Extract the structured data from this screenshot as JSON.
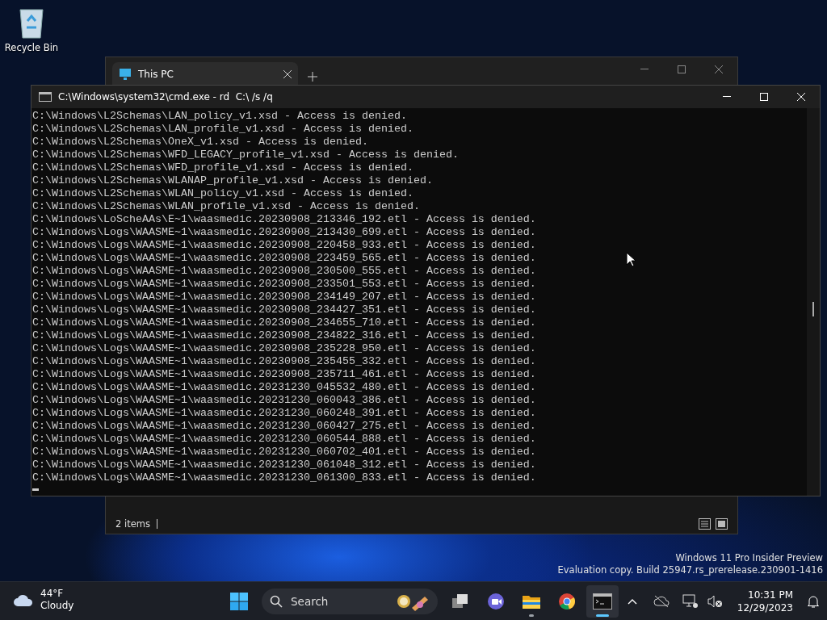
{
  "desktop_icons": [
    {
      "label": "Recycle Bin"
    }
  ],
  "explorer": {
    "tabs": [
      {
        "title": "This PC",
        "selected": true
      }
    ],
    "status": "2 items"
  },
  "console": {
    "title": "C:\\Windows\\system32\\cmd.exe - rd  C:\\ /s /q",
    "lines": [
      "C:\\Windows\\L2Schemas\\LAN_policy_v1.xsd - Access is denied.",
      "C:\\Windows\\L2Schemas\\LAN_profile_v1.xsd - Access is denied.",
      "C:\\Windows\\L2Schemas\\OneX_v1.xsd - Access is denied.",
      "C:\\Windows\\L2Schemas\\WFD_LEGACY_profile_v1.xsd - Access is denied.",
      "C:\\Windows\\L2Schemas\\WFD_profile_v1.xsd - Access is denied.",
      "C:\\Windows\\L2Schemas\\WLANAP_profile_v1.xsd - Access is denied.",
      "C:\\Windows\\L2Schemas\\WLAN_policy_v1.xsd - Access is denied.",
      "C:\\Windows\\L2Schemas\\WLAN_profile_v1.xsd - Access is denied.",
      "C:\\Windows\\LoScheAAs\\E~1\\waasmedic.20230908_213346_192.etl - Access is denied.",
      "C:\\Windows\\Logs\\WAASME~1\\waasmedic.20230908_213430_699.etl - Access is denied.",
      "C:\\Windows\\Logs\\WAASME~1\\waasmedic.20230908_220458_933.etl - Access is denied.",
      "C:\\Windows\\Logs\\WAASME~1\\waasmedic.20230908_223459_565.etl - Access is denied.",
      "C:\\Windows\\Logs\\WAASME~1\\waasmedic.20230908_230500_555.etl - Access is denied.",
      "C:\\Windows\\Logs\\WAASME~1\\waasmedic.20230908_233501_553.etl - Access is denied.",
      "C:\\Windows\\Logs\\WAASME~1\\waasmedic.20230908_234149_207.etl - Access is denied.",
      "C:\\Windows\\Logs\\WAASME~1\\waasmedic.20230908_234427_351.etl - Access is denied.",
      "C:\\Windows\\Logs\\WAASME~1\\waasmedic.20230908_234655_710.etl - Access is denied.",
      "C:\\Windows\\Logs\\WAASME~1\\waasmedic.20230908_234822_316.etl - Access is denied.",
      "C:\\Windows\\Logs\\WAASME~1\\waasmedic.20230908_235228_950.etl - Access is denied.",
      "C:\\Windows\\Logs\\WAASME~1\\waasmedic.20230908_235455_332.etl - Access is denied.",
      "C:\\Windows\\Logs\\WAASME~1\\waasmedic.20230908_235711_461.etl - Access is denied.",
      "C:\\Windows\\Logs\\WAASME~1\\waasmedic.20231230_045532_480.etl - Access is denied.",
      "C:\\Windows\\Logs\\WAASME~1\\waasmedic.20231230_060043_386.etl - Access is denied.",
      "C:\\Windows\\Logs\\WAASME~1\\waasmedic.20231230_060248_391.etl - Access is denied.",
      "C:\\Windows\\Logs\\WAASME~1\\waasmedic.20231230_060427_275.etl - Access is denied.",
      "C:\\Windows\\Logs\\WAASME~1\\waasmedic.20231230_060544_888.etl - Access is denied.",
      "C:\\Windows\\Logs\\WAASME~1\\waasmedic.20231230_060702_401.etl - Access is denied.",
      "C:\\Windows\\Logs\\WAASME~1\\waasmedic.20231230_061048_312.etl - Access is denied.",
      "C:\\Windows\\Logs\\WAASME~1\\waasmedic.20231230_061300_833.etl - Access is denied."
    ]
  },
  "os_notice": {
    "edition": "Windows 11 Pro Insider Preview",
    "build": "Evaluation copy. Build 25947.rs_prerelease.230901-1416"
  },
  "taskbar": {
    "weather": {
      "temperature": "44°F",
      "condition": "Cloudy"
    },
    "search": {
      "placeholder": "Search"
    },
    "apps": [
      {
        "kind": "taskview",
        "running": false,
        "active": false
      },
      {
        "kind": "chat",
        "running": false,
        "active": false
      },
      {
        "kind": "files",
        "running": true,
        "active": false
      },
      {
        "kind": "browser",
        "running": false,
        "active": false
      },
      {
        "kind": "terminal",
        "running": true,
        "active": true
      }
    ],
    "clock": {
      "time": "10:31 PM",
      "date": "12/29/2023"
    }
  }
}
